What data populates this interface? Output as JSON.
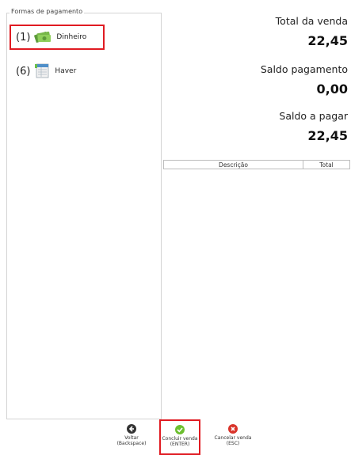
{
  "payment_group": {
    "title": "Formas de pagamento",
    "items": [
      {
        "key": "(1)",
        "label": "Dinheiro",
        "icon": "money-bills-icon",
        "selected": true
      },
      {
        "key": "(6)",
        "label": "Haver",
        "icon": "ledger-icon",
        "selected": false
      }
    ]
  },
  "totals": {
    "total_label": "Total da venda",
    "total_value": "22,45",
    "saldo_pag_label": "Saldo pagamento",
    "saldo_pag_value": "0,00",
    "saldo_pagar_label": "Saldo a pagar",
    "saldo_pagar_value": "22,45"
  },
  "table": {
    "headers": [
      "Descrição",
      "Total"
    ]
  },
  "actions": {
    "voltar": {
      "line1": "Voltar",
      "line2": "(Backspace)"
    },
    "concluir": {
      "line1": "Concluir venda",
      "line2": "(ENTER)"
    },
    "cancelar": {
      "line1": "Cancelar venda",
      "line2": "(ESC)"
    }
  },
  "colors": {
    "highlight": "#e01b22",
    "confirm": "#6cbf2f",
    "cancel": "#d9342b",
    "back": "#333333"
  }
}
